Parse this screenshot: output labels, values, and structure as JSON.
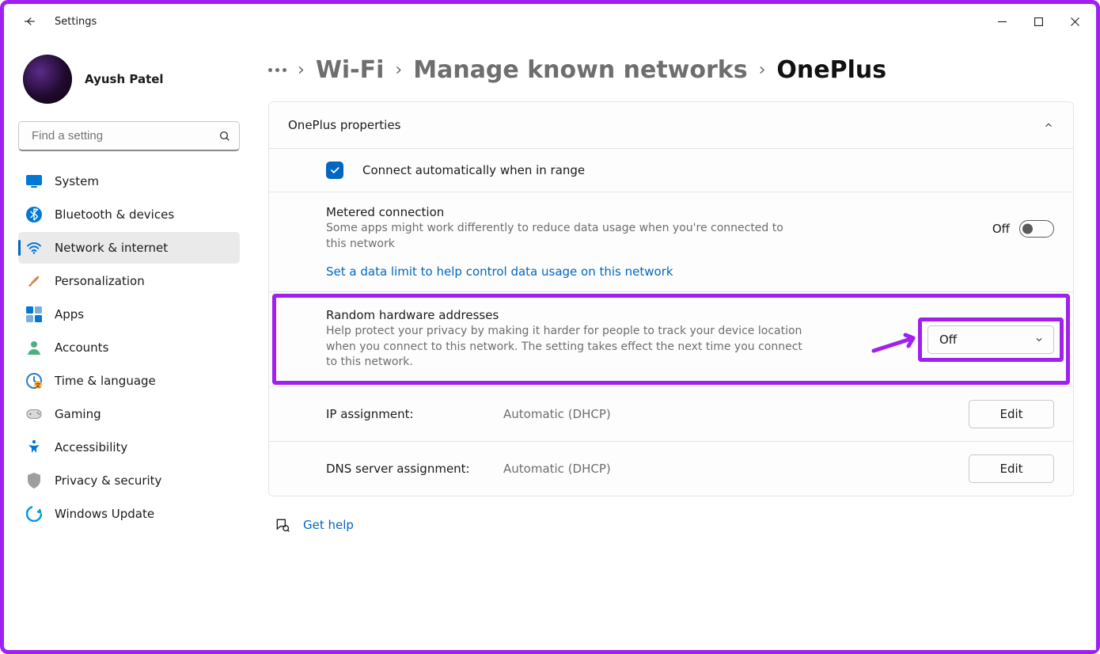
{
  "window": {
    "app_title": "Settings"
  },
  "profile": {
    "name": "Ayush Patel"
  },
  "search": {
    "placeholder": "Find a setting"
  },
  "sidebar": {
    "items": [
      {
        "label": "System",
        "icon": "system"
      },
      {
        "label": "Bluetooth & devices",
        "icon": "bluetooth"
      },
      {
        "label": "Network & internet",
        "icon": "wifi",
        "selected": true
      },
      {
        "label": "Personalization",
        "icon": "brush"
      },
      {
        "label": "Apps",
        "icon": "apps"
      },
      {
        "label": "Accounts",
        "icon": "account"
      },
      {
        "label": "Time & language",
        "icon": "time"
      },
      {
        "label": "Gaming",
        "icon": "gaming"
      },
      {
        "label": "Accessibility",
        "icon": "accessibility"
      },
      {
        "label": "Privacy & security",
        "icon": "privacy"
      },
      {
        "label": "Windows Update",
        "icon": "update"
      }
    ]
  },
  "breadcrumb": {
    "wifi": "Wi-Fi",
    "manage": "Manage known networks",
    "current": "OnePlus"
  },
  "panel": {
    "header": "OnePlus properties",
    "auto_connect": "Connect automatically when in range",
    "metered": {
      "title": "Metered connection",
      "desc": "Some apps might work differently to reduce data usage when you're connected to this network",
      "state": "Off"
    },
    "data_limit_link": "Set a data limit to help control data usage on this network",
    "random_hw": {
      "title": "Random hardware addresses",
      "desc": "Help protect your privacy by making it harder for people to track your device location when you connect to this network. The setting takes effect the next time you connect to this network.",
      "value": "Off"
    },
    "ip": {
      "label": "IP assignment:",
      "value": "Automatic (DHCP)",
      "edit": "Edit"
    },
    "dns": {
      "label": "DNS server assignment:",
      "value": "Automatic (DHCP)",
      "edit": "Edit"
    }
  },
  "get_help": "Get help"
}
